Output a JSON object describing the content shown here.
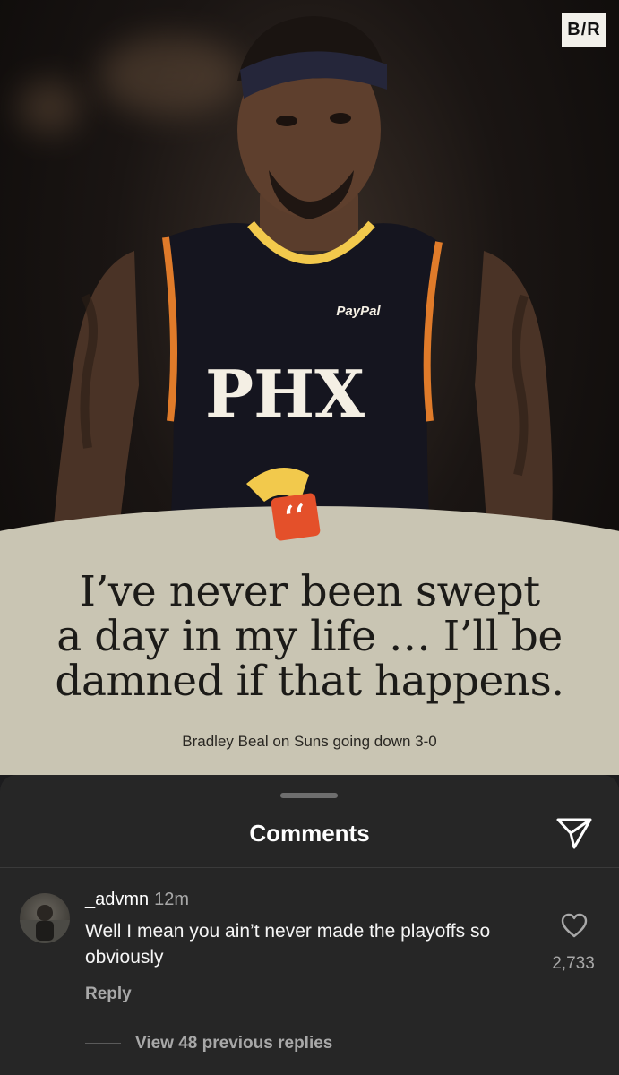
{
  "post": {
    "brand_logo": "B/R",
    "jersey_text": "PHX",
    "jersey_sponsor": "PayPal",
    "quote_lines": [
      "I’ve never been swept",
      "a day in my life … I’ll be",
      "damned if that happens."
    ],
    "caption": "Bradley Beal on Suns going down 3-0",
    "quote_mark": "‘‘",
    "accent_color": "#e4502a",
    "panel_color": "#c9c5b3"
  },
  "comments_sheet": {
    "title": "Comments",
    "send_icon": "send-icon",
    "comment": {
      "username": "_advmn",
      "time": "12m",
      "text": "Well I mean you ain’t never made the playoffs so obviously",
      "like_count": "2,733",
      "reply_label": "Reply"
    },
    "view_replies_label": "View 48 previous replies"
  }
}
